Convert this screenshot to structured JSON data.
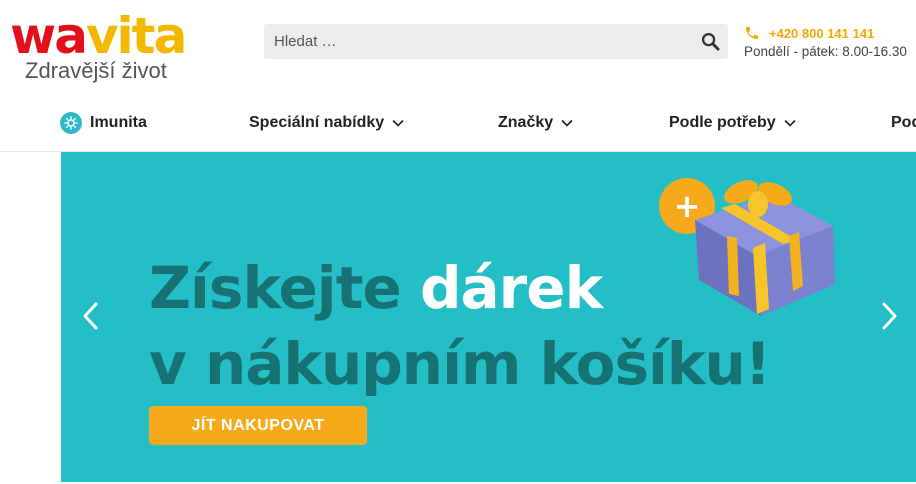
{
  "brand": {
    "logo_part1": "wa",
    "logo_part2": "vita",
    "tagline": "Zdravější život"
  },
  "search": {
    "placeholder": "Hledat …"
  },
  "contact": {
    "phone": "+420 800 141 141",
    "hours": "Pondělí - pátek: 8.00-16.30"
  },
  "nav": {
    "items": [
      {
        "label": "Imunita"
      },
      {
        "label": "Speciální nabídky"
      },
      {
        "label": "Značky"
      },
      {
        "label": "Podle potřeby"
      },
      {
        "label": "Pod"
      }
    ]
  },
  "banner": {
    "line1_part1": "Získejte",
    "line1_part2": "dárek",
    "line2": "v nákupním košíku!",
    "cta": "JÍT NAKUPOVAT",
    "plus_badge": "+"
  },
  "colors": {
    "accent_orange": "#f5a91b",
    "banner_bg": "#24bec6",
    "headline_dark": "#177373",
    "logo_red": "#e3101b",
    "logo_yellow": "#f5b800"
  },
  "icons": [
    "search-icon",
    "phone-icon",
    "immunity-icon",
    "chevron-down-icon",
    "arrow-left-icon",
    "arrow-right-icon",
    "gift-icon"
  ]
}
